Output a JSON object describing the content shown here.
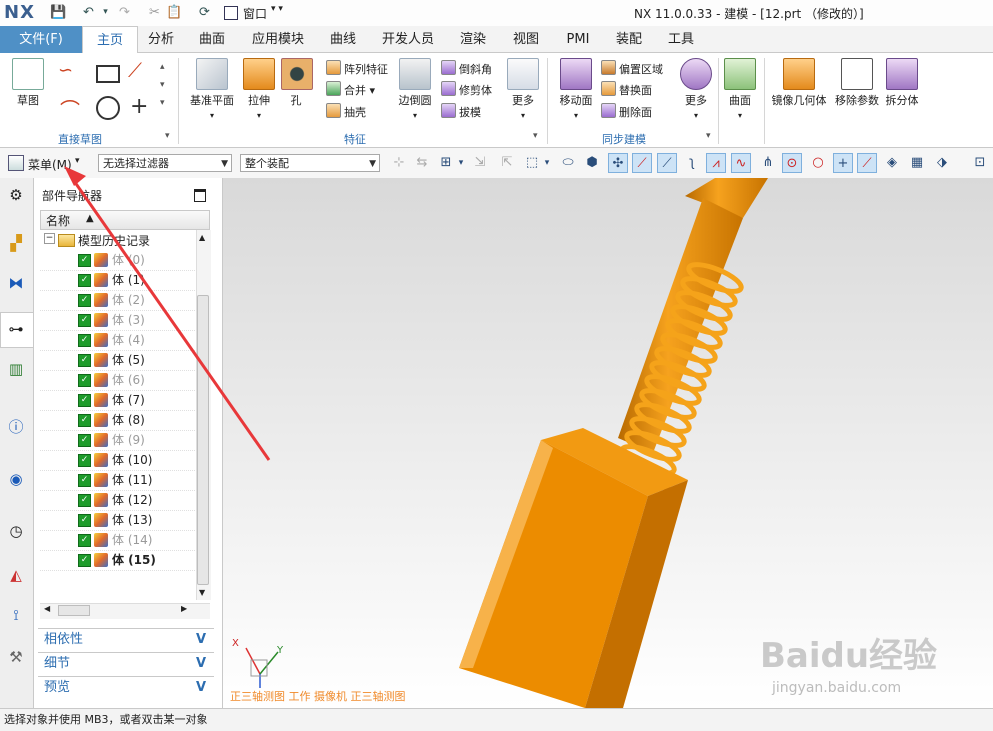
{
  "app": {
    "logo": "NX",
    "title": "NX 11.0.0.33 - 建模 - [12.prt （修改的）]",
    "window_menu": "窗口"
  },
  "tabs": [
    "文件(F)",
    "主页",
    "分析",
    "曲面",
    "应用模块",
    "曲线",
    "开发人员",
    "渲染",
    "视图",
    "PMI",
    "装配",
    "工具"
  ],
  "active_tab": "主页",
  "ribbon": {
    "sketch": "草图",
    "group_direct_sketch": "直接草图",
    "datum_plane": "基准平面",
    "extrude": "拉伸",
    "hole": "孔",
    "pattern_feature": "阵列特征",
    "unite": "合并",
    "shell": "抽壳",
    "edge_blend": "边倒圆",
    "chamfer": "倒斜角",
    "trim_body": "修剪体",
    "draft": "拔模",
    "more_feature": "更多",
    "group_feature": "特征",
    "move_face": "移动面",
    "offset_region": "偏置区域",
    "replace_face": "替换面",
    "delete_face": "删除面",
    "more_sync": "更多",
    "group_sync": "同步建模",
    "surface": "曲面",
    "mirror_geometry": "镜像几何体",
    "remove_parameters": "移除参数",
    "split_body": "拆分体"
  },
  "selection_bar": {
    "menu": "菜单(M)",
    "filter": "无选择过滤器",
    "scope": "整个装配"
  },
  "navigator": {
    "title": "部件导航器",
    "column_name": "名称",
    "root": "模型历史记录",
    "items": [
      {
        "label": "体 (0)",
        "state": "dim"
      },
      {
        "label": "体 (1)",
        "state": "normal"
      },
      {
        "label": "体 (2)",
        "state": "dim"
      },
      {
        "label": "体 (3)",
        "state": "dim"
      },
      {
        "label": "体 (4)",
        "state": "dim"
      },
      {
        "label": "体 (5)",
        "state": "normal"
      },
      {
        "label": "体 (6)",
        "state": "dim"
      },
      {
        "label": "体 (7)",
        "state": "normal"
      },
      {
        "label": "体 (8)",
        "state": "normal"
      },
      {
        "label": "体 (9)",
        "state": "dim"
      },
      {
        "label": "体 (10)",
        "state": "normal"
      },
      {
        "label": "体 (11)",
        "state": "normal"
      },
      {
        "label": "体 (12)",
        "state": "normal"
      },
      {
        "label": "体 (13)",
        "state": "normal"
      },
      {
        "label": "体 (14)",
        "state": "dim"
      },
      {
        "label": "体 (15)",
        "state": "bold"
      }
    ],
    "panels": [
      "相依性",
      "细节",
      "预览"
    ]
  },
  "viewport": {
    "view_label": "正三轴测图 工作 摄像机 正三轴测图",
    "triad_x": "X",
    "triad_y": "Y"
  },
  "status": "选择对象并使用 MB3，或者双击某一对象",
  "watermark": {
    "brand": "Baidu经验",
    "url": "jingyan.baidu.com"
  },
  "colors": {
    "accent": "#4f90c6",
    "model": "#f0930f",
    "arrow": "#e8383a"
  }
}
